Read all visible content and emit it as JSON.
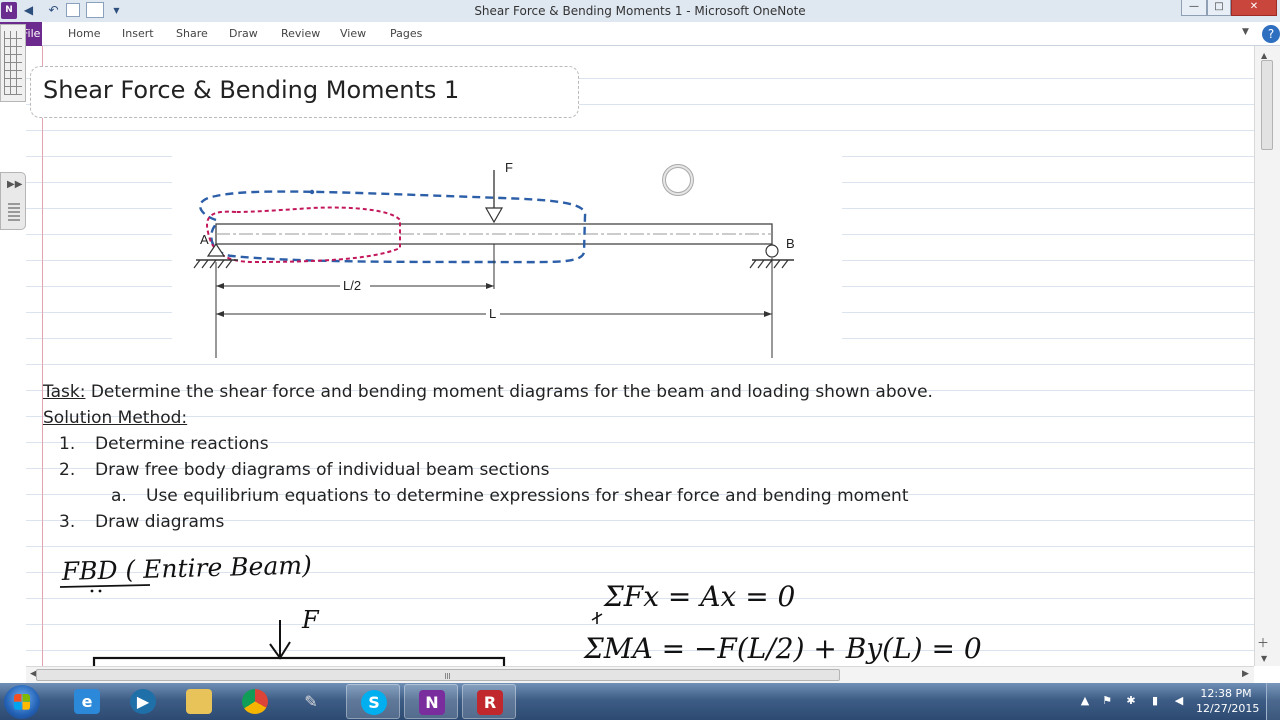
{
  "window": {
    "title": "Shear Force & Bending Moments 1 - Microsoft OneNote",
    "app_icon": "N",
    "controls": {
      "minimize": "—",
      "maximize": "□",
      "close": "✕"
    }
  },
  "ribbon": {
    "file_label": "File",
    "tabs": [
      "Home",
      "Insert",
      "Share",
      "Draw",
      "Review",
      "View",
      "Pages"
    ],
    "help": "?"
  },
  "page": {
    "title": "Shear Force & Bending Moments 1"
  },
  "figure": {
    "load_label": "F",
    "support_a": "A",
    "support_b": "B",
    "dim_half": "L/2",
    "dim_full": "L"
  },
  "task": {
    "label": "Task:",
    "text": " Determine the shear force and bending moment diagrams for the beam and loading shown above.",
    "method_label": "Solution Method:",
    "steps": [
      {
        "n": "1.",
        "text": "Determine reactions"
      },
      {
        "n": "2.",
        "text": "Draw free body diagrams of individual beam sections"
      },
      {
        "n": "a.",
        "text": "Use equilibrium equations to determine expressions for shear  force and bending moment"
      },
      {
        "n": "3.",
        "text": "Draw diagrams"
      }
    ]
  },
  "handwriting": {
    "fbd": "FBD ( Entire Beam)",
    "load": "F",
    "eq1": "ΣFx = Ax = 0",
    "eq2": "ΣMA = −F(L/2) + By(L) = 0"
  },
  "colors": {
    "file_tab": "#6d2a8e",
    "deflection_blue": "#2c5fa8",
    "deflection_red": "#c2185b",
    "ink": "#111111"
  },
  "taskbar": {
    "apps": [
      "ie-icon",
      "media-player-icon",
      "explorer-icon",
      "chrome-icon",
      "pen-icon",
      "skype-icon",
      "onenote-icon",
      "recorder-icon"
    ],
    "clock_time": "12:38 PM",
    "clock_date": "12/27/2015"
  }
}
